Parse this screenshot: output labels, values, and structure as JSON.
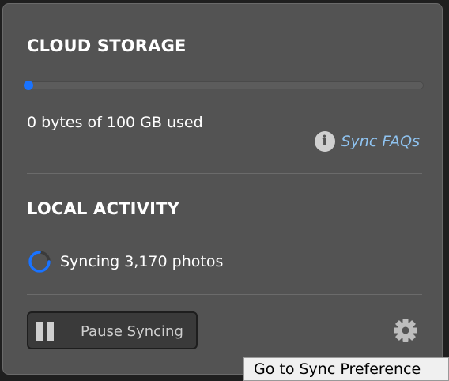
{
  "cloud_storage": {
    "title": "CLOUD STORAGE",
    "used_fraction": 0.0,
    "usage_text": "0 bytes of 100 GB used",
    "faq_link_label": "Sync FAQs",
    "faq_icon": "info-icon",
    "accent_color": "#1a73ff",
    "link_color": "#8fc3f0"
  },
  "local_activity": {
    "title": "LOCAL ACTIVITY",
    "status_icon": "spinner-icon",
    "status_text": "Syncing 3,170 photos"
  },
  "footer": {
    "pause_icon": "pause-icon",
    "pause_label": "Pause Syncing",
    "settings_icon": "gear-icon"
  },
  "tooltip": {
    "text": "Go to Sync Preference"
  }
}
